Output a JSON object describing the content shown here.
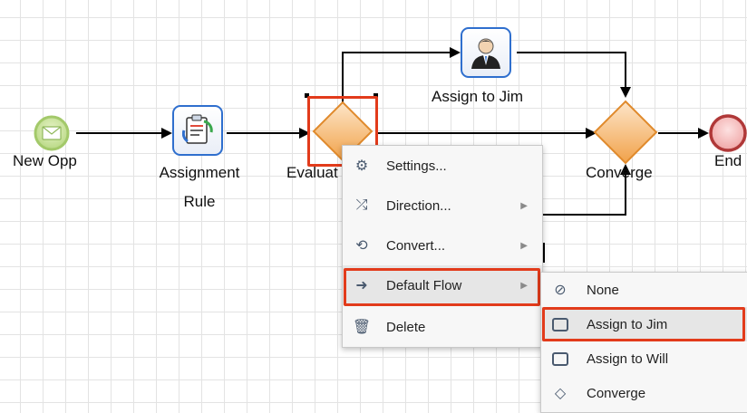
{
  "nodes": {
    "start_label": "New Opp",
    "assignment_label_line1": "Assignment",
    "assignment_label_line2": "Rule",
    "evaluate_label": "Evaluat",
    "assign_jim_label": "Assign to Jim",
    "converge_label": "Converge",
    "end_label": "End"
  },
  "context_menu": {
    "items": [
      {
        "label": "Settings...",
        "icon": "gear-icon",
        "submenu": false
      },
      {
        "label": "Direction...",
        "icon": "shuffle-icon",
        "submenu": true
      },
      {
        "label": "Convert...",
        "icon": "convert-icon",
        "submenu": true
      },
      {
        "label": "Default Flow",
        "icon": "arrow-right-icon",
        "submenu": true,
        "highlighted": true
      },
      {
        "label": "Delete",
        "icon": "trash-icon",
        "submenu": false
      }
    ]
  },
  "default_flow_submenu": {
    "items": [
      {
        "label": "None",
        "icon": "none-icon"
      },
      {
        "label": "Assign to Jim",
        "icon": "task-icon",
        "selected": true
      },
      {
        "label": "Assign to Will",
        "icon": "task-icon"
      },
      {
        "label": "Converge",
        "icon": "gateway-icon"
      }
    ]
  },
  "colors": {
    "highlight": "#e23b1b",
    "task_border": "#2f6fce",
    "gateway_fill": "#f6b26b",
    "start_fill": "#c9e39a",
    "end_fill": "#f4b3b3"
  }
}
